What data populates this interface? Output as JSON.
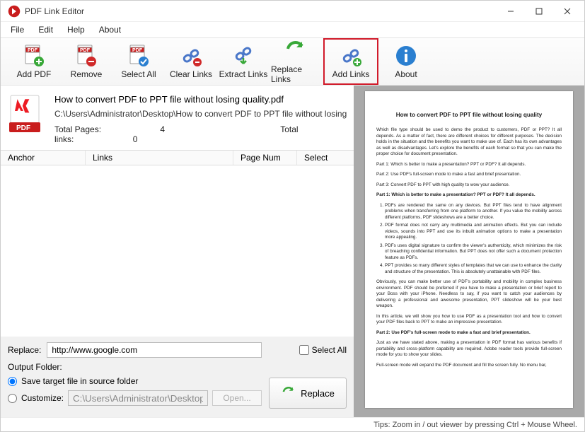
{
  "title": "PDF Link Editor",
  "menubar": [
    "File",
    "Edit",
    "Help",
    "About"
  ],
  "toolbar": [
    {
      "id": "add-pdf",
      "label": "Add PDF"
    },
    {
      "id": "remove",
      "label": "Remove"
    },
    {
      "id": "select-all",
      "label": "Select All"
    },
    {
      "id": "clear-links",
      "label": "Clear Links"
    },
    {
      "id": "extract-links",
      "label": "Extract Links"
    },
    {
      "id": "replace-links",
      "label": "Replace Links"
    },
    {
      "id": "add-links",
      "label": "Add Links",
      "highlight": true
    },
    {
      "id": "about",
      "label": "About"
    }
  ],
  "file": {
    "name": "How to convert PDF to PPT file without losing quality.pdf",
    "path": "C:\\Users\\Administrator\\Desktop\\How to convert PDF to PPT file without losing",
    "total_pages_label": "Total Pages:",
    "total_pages": "4",
    "total_links_label": "Total links:",
    "total_links": "0"
  },
  "columns": {
    "anchor": "Anchor",
    "links": "Links",
    "page_num": "Page Num",
    "select": "Select"
  },
  "replace": {
    "label": "Replace:",
    "value": "http://www.google.com",
    "select_all": "Select All",
    "output_label": "Output Folder:",
    "opt_source": "Save target file in source folder",
    "opt_custom": "Customize:",
    "custom_path": "C:\\Users\\Administrator\\Desktop",
    "open": "Open...",
    "button": "Replace"
  },
  "preview": {
    "title": "How to convert PDF to PPT file without losing quality",
    "p1": "Which file type should be used to demo the product to customers, PDF or PPT? It all depends. As a matter of fact, there are different choices for different purposes. The decision holds in the situation and the benefits you want to make use of. Each has its own advantages as well as disadvantages. Let's explore the benefits of each format so that you can make the proper choice for document presentation.",
    "p2": "Part 1: Which is better to make a presentation? PPT or PDF? It all depends.",
    "p3": "Part 2: Use PDF's full-screen mode to make a fast and brief presentation.",
    "p4": "Part 3: Convert PDF to PPT with high quality to wow your audience.",
    "h1": "Part 1: Which is better to make a presentation? PPT or PDF? It all depends.",
    "li1": "PDFs are rendered the same on any devices. But PPT files tend to have alignment problems when transferring from one platform to another. If you value the mobility across different platforms, PDF slideshows are a better choice.",
    "li2": "PDF format does not carry any multimedia and animation effects. But you can include videos, sounds into PPT and use its inbuilt animation options to make a presentation more appealing.",
    "li3": "PDFs uses digital signature to confirm the viewer's authenticity, which minimizes the risk of breaching confidential information. But PPT does not offer such a document protection feature as PDFs.",
    "li4": "PPT provides so many different styles of templates that we can use to enhance the clarity and structure of the presentation. This is absolutely unattainable with PDF files.",
    "p5": "Obviously, you can make better use of PDF's portability and mobility in complex business environment. PDF should be preferred if you have to make a presentation or brief report to your Boss with your iPhone. Needless to say, if you want to catch your audiences by delivering a professional and awesome presentation, PPT slideshow will be your best weapon.",
    "p6": "In this article, we will show you how to use PDF as a presentation tool and how to convert your PDF files back to PPT to make an impressive presentation.",
    "h2": "Part 2: Use PDF's full-screen mode to make a fast and brief presentation.",
    "p7": "Just as we have stated above, making a presentation in PDF format has various benefits if portability and cross-platform capability are required. Adobe reader tools provide full-screen mode for you to show your slides.",
    "p8": "Full-screen mode will expand the PDF document and fill the screen fully. No menu bar,"
  },
  "statusbar": "Tips: Zoom in / out viewer by pressing Ctrl + Mouse Wheel."
}
